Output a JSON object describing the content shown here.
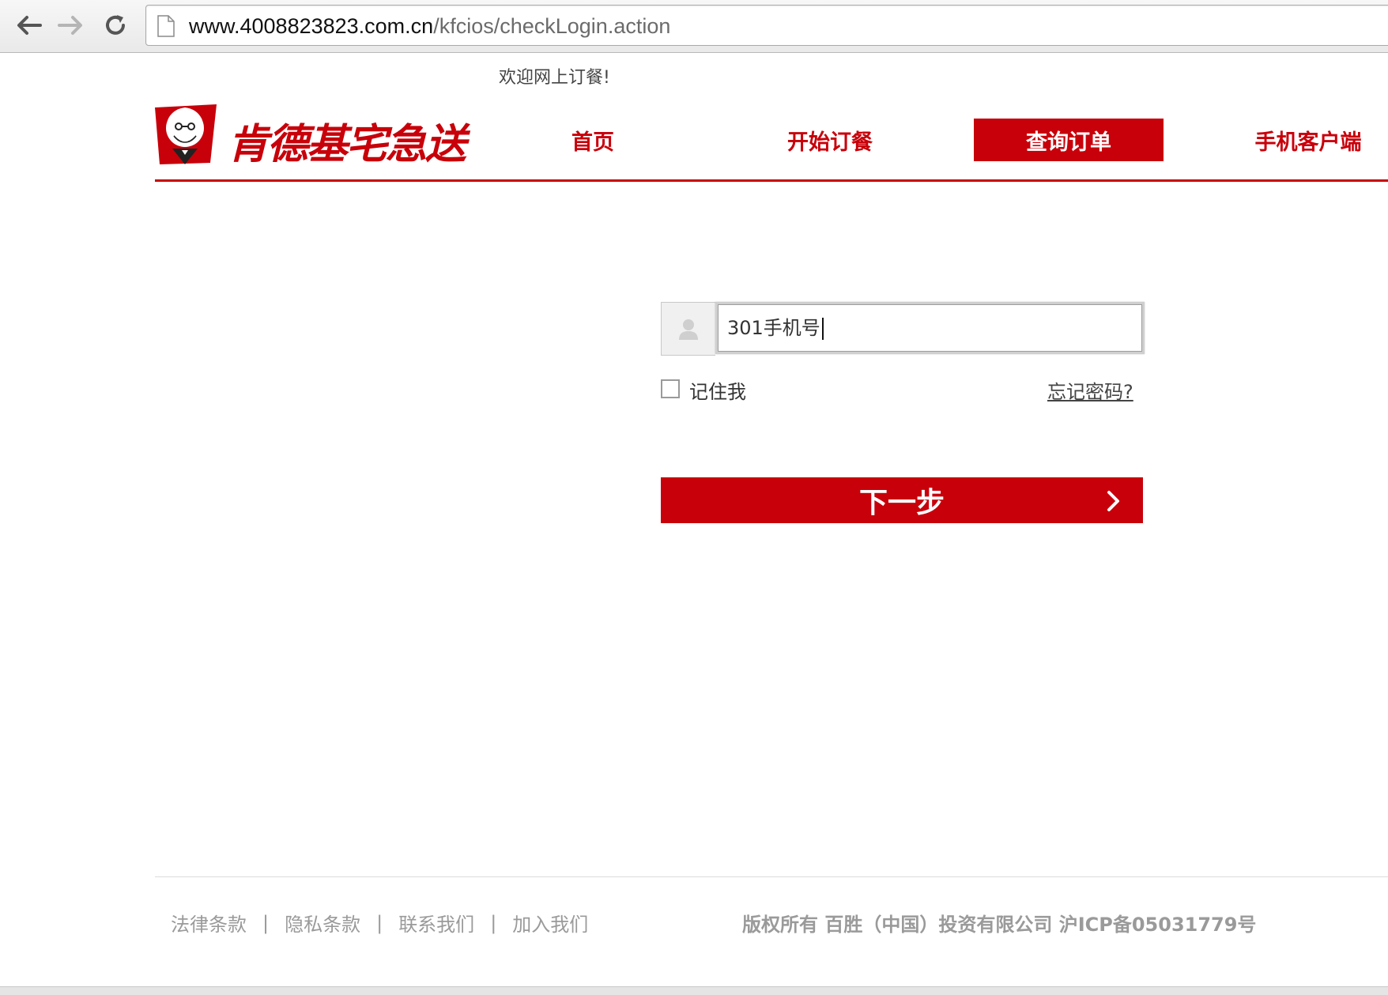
{
  "browser": {
    "url_host": "www.4008823823.com.cn",
    "url_path": "/kfcios/checkLogin.action",
    "icons": [
      "back-arrow-icon",
      "forward-arrow-icon",
      "reload-icon",
      "page-icon"
    ]
  },
  "header": {
    "welcome": "欢迎网上订餐!",
    "logo_text": "肯德基宅急送",
    "nav": [
      {
        "label": "首页"
      },
      {
        "label": "开始订餐"
      },
      {
        "label": "查询订单"
      },
      {
        "label": "手机客户端"
      }
    ]
  },
  "login": {
    "phone_value": "301手机号",
    "remember_label": "记住我",
    "forgot_label": "忘记密码?",
    "next_label": "下一步"
  },
  "footer": {
    "links": [
      {
        "label": "法律条款"
      },
      {
        "label": "隐私条款"
      },
      {
        "label": "联系我们"
      },
      {
        "label": "加入我们"
      }
    ],
    "separator": "|",
    "copyright": "版权所有 百胜（中国）投资有限公司 沪ICP备05031779号"
  },
  "colors": {
    "brand_red": "#c8000a",
    "footer_gray": "#9a9a9a"
  }
}
